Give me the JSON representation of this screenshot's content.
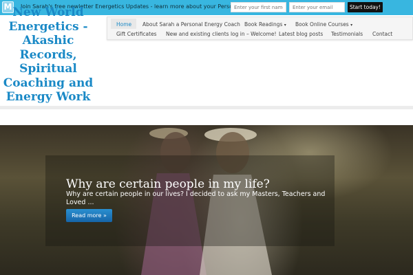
{
  "topbar": {
    "logo_letter": "M",
    "message_prefix": "Join Sarah's free newletter Energetics Updates - ",
    "message_link": "learn more about your Personal Energy!",
    "first_name_placeholder": "Enter your first name",
    "email_placeholder": "Enter your email",
    "start_label": "Start today!",
    "color": "#38b6e0"
  },
  "site": {
    "title": "New World Energetics - Akashic Records, Spiritual Coaching and Energy Work",
    "title_color": "#1a89c6"
  },
  "nav": {
    "items": [
      {
        "label": "Home"
      },
      {
        "label": "About Sarah a Personal Energy Coach"
      },
      {
        "label": "Book Readings"
      },
      {
        "label": "Book Online Courses"
      },
      {
        "label": "Gift Certificates"
      },
      {
        "label": "New and existing clients log in – Welcome!"
      },
      {
        "label": "Latest blog posts"
      },
      {
        "label": "Testimonials"
      },
      {
        "label": "Contact"
      }
    ],
    "dropdown_caret": "▾"
  },
  "hero": {
    "title": "Why are certain people in my life?",
    "text": "Why are certain people in our lives? I decided to ask my Masters, Teachers and Loved ...",
    "button_label": "Read more »",
    "button_color": "#1a7cc0"
  }
}
